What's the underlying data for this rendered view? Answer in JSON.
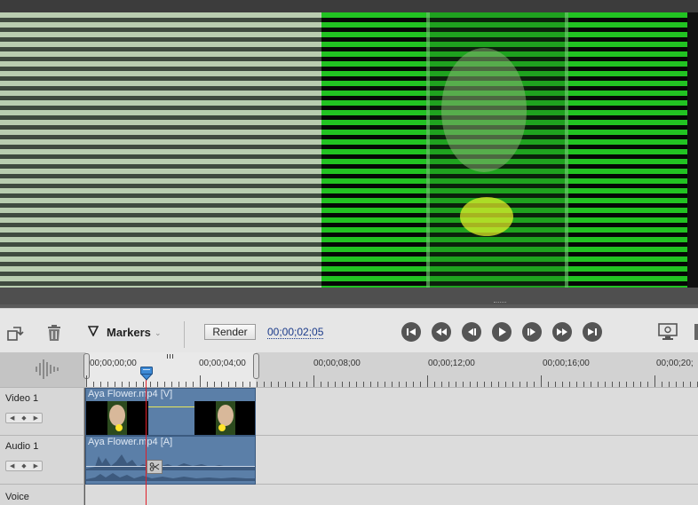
{
  "toolbar": {
    "markers_label": "Markers",
    "render_label": "Render",
    "timecode": "00;00;02;05"
  },
  "ruler": {
    "labels": [
      "00;00;00;00",
      "00;00;04;00",
      "00;00;08;00",
      "00;00;12;00",
      "00;00;16;00",
      "00;00;20;"
    ]
  },
  "tracks": {
    "video1": {
      "name": "Video 1",
      "clip_label": "Aya Flower.mp4 [V]"
    },
    "audio1": {
      "name": "Audio 1",
      "clip_label": "Aya Flower.mp4 [A]"
    },
    "voice": {
      "name": "Voice"
    }
  },
  "icons": [
    "rotate-icon",
    "trash-icon",
    "marker-icon",
    "go-to-start-icon",
    "rewind-icon",
    "step-back-icon",
    "play-icon",
    "step-forward-icon",
    "fast-forward-icon",
    "go-to-end-icon",
    "monitor-settings-icon",
    "scissors-icon"
  ],
  "colors": {
    "clip_blue": "#5b7fa8",
    "playhead_red": "#e0202a",
    "timecode_blue": "#1a3a8a",
    "glitch_green": "#22c322"
  }
}
